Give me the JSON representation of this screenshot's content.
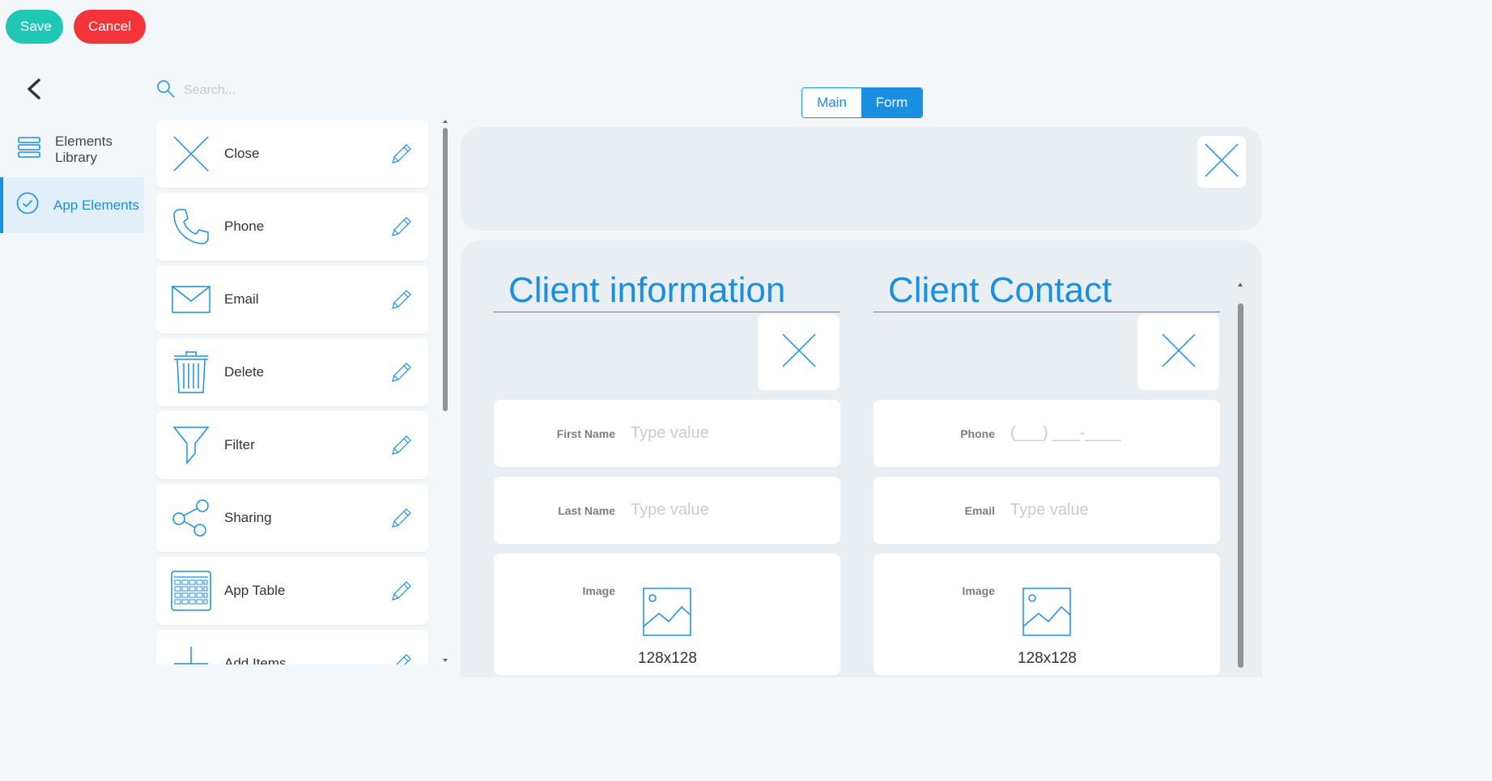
{
  "toolbar": {
    "save_label": "Save",
    "cancel_label": "Cancel"
  },
  "nav": {
    "items": [
      {
        "label": "Elements Library",
        "icon": "layers-icon",
        "active": false
      },
      {
        "label": "App Elements",
        "icon": "check-circle-icon",
        "active": true
      }
    ]
  },
  "search": {
    "placeholder": "Search..."
  },
  "library": {
    "items": [
      {
        "label": "Close",
        "icon": "close-icon"
      },
      {
        "label": "Phone",
        "icon": "phone-icon"
      },
      {
        "label": "Email",
        "icon": "envelope-icon"
      },
      {
        "label": "Delete",
        "icon": "trash-icon"
      },
      {
        "label": "Filter",
        "icon": "filter-icon"
      },
      {
        "label": "Sharing",
        "icon": "share-icon"
      },
      {
        "label": "App Table",
        "icon": "table-icon"
      },
      {
        "label": "Add Items",
        "icon": "plus-icon"
      }
    ]
  },
  "view_toggle": {
    "main_label": "Main",
    "form_label": "Form",
    "selected": "Form"
  },
  "form": {
    "client_info": {
      "title": "Client information",
      "first_name": {
        "label": "First Name",
        "placeholder": "Type value"
      },
      "last_name": {
        "label": "Last Name",
        "placeholder": "Type value"
      },
      "image": {
        "label": "Image",
        "size": "128x128"
      }
    },
    "client_contact": {
      "title": "Client Contact",
      "phone": {
        "label": "Phone",
        "placeholder": "(___) ___-____"
      },
      "email": {
        "label": "Email",
        "placeholder": "Type value"
      },
      "image": {
        "label": "Image",
        "size": "128x128"
      }
    }
  },
  "colors": {
    "accent": "#1a8fe0",
    "save": "#1fc7b4",
    "cancel": "#f5343a"
  }
}
